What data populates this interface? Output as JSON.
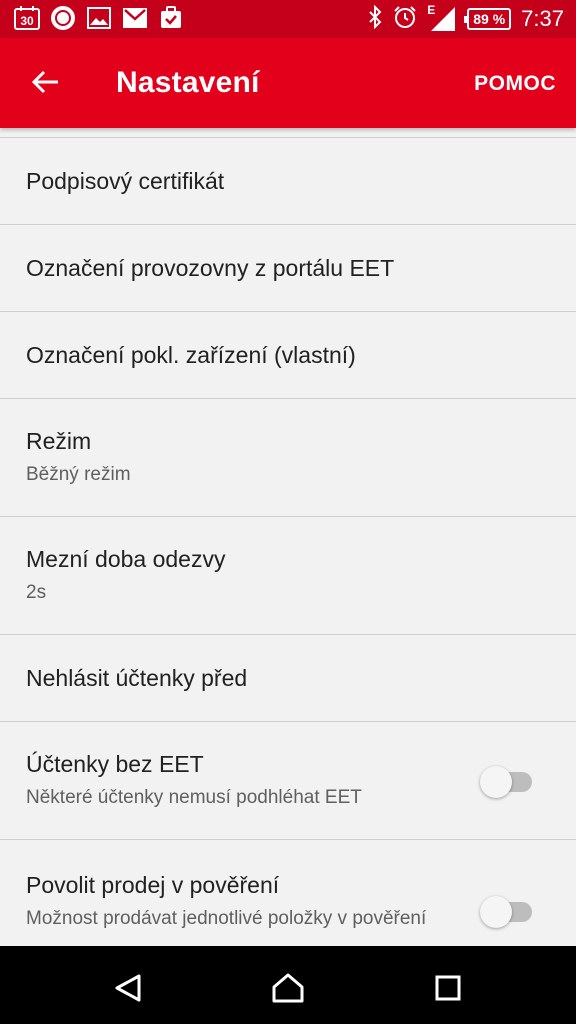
{
  "status_bar": {
    "left_icons": [
      "calendar-icon",
      "mi-app-icon",
      "image-icon",
      "gmail-icon",
      "task-icon"
    ],
    "calendar_day": "30",
    "right_icons": [
      "bluetooth-icon",
      "alarm-icon",
      "signal-icon",
      "battery-icon"
    ],
    "network_label": "E",
    "battery_percent": "89 %",
    "time": "7:37"
  },
  "app_bar": {
    "title": "Nastavení",
    "action_label": "POMOC",
    "back_icon": "arrow-back-icon"
  },
  "settings": [
    {
      "title": "Podpisový certifikát"
    },
    {
      "title": "Označení provozovny z portálu EET"
    },
    {
      "title": "Označení pokl. zařízení (vlastní)"
    },
    {
      "title": "Režim",
      "summary": "Běžný režim"
    },
    {
      "title": "Mezní doba odezvy",
      "summary": "2s"
    },
    {
      "title": "Nehlásit účtenky před"
    },
    {
      "title": "Účtenky bez EET",
      "summary": "Některé účtenky nemusí podhléhat EET",
      "switch_on": false
    },
    {
      "title": "Povolit prodej v pověření",
      "summary": "Možnost prodávat jednotlivé položky v pověření",
      "switch_on": false
    }
  ],
  "nav_bar": {
    "icons": [
      "back-triangle-icon",
      "home-icon",
      "recents-icon"
    ]
  }
}
